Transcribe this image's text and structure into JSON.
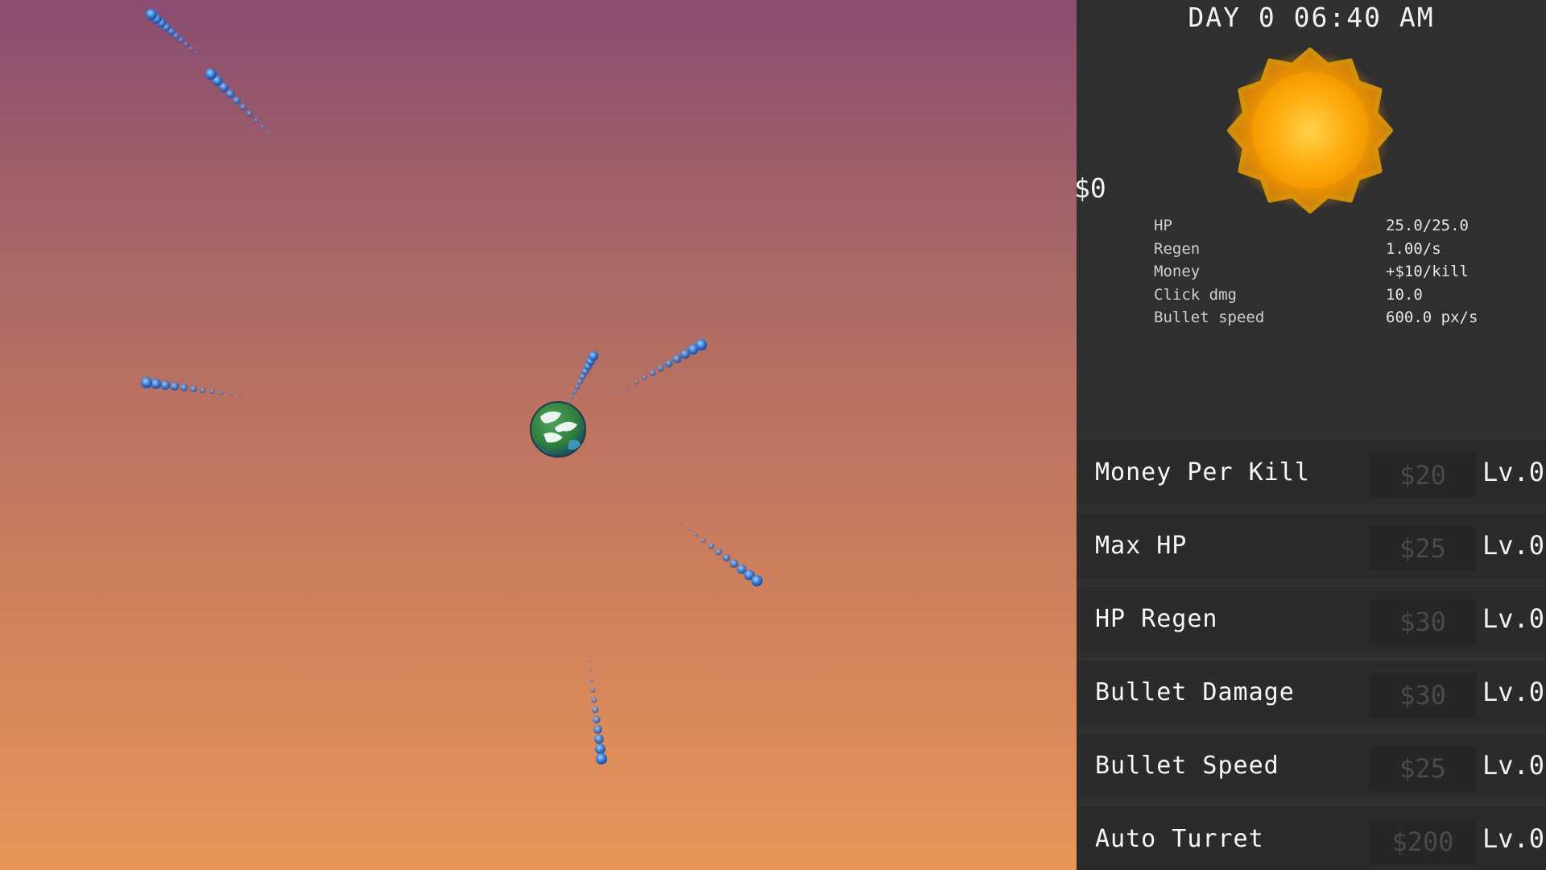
{
  "hud": {
    "clock": "DAY 0 06:40 AM",
    "money": "$0"
  },
  "stats": [
    {
      "label": "HP",
      "value": "25.0/25.0"
    },
    {
      "label": "Regen",
      "value": "1.00/s"
    },
    {
      "label": "Money",
      "value": "+$10/kill"
    },
    {
      "label": "Click dmg",
      "value": "10.0"
    },
    {
      "label": "Bullet speed",
      "value": "600.0 px/s"
    }
  ],
  "upgrades": [
    {
      "name": "Money Per Kill",
      "cost": "$20",
      "level": "Lv.0"
    },
    {
      "name": "Max HP",
      "cost": "$25",
      "level": "Lv.0"
    },
    {
      "name": "HP Regen",
      "cost": "$30",
      "level": "Lv.0"
    },
    {
      "name": "Bullet Damage",
      "cost": "$30",
      "level": "Lv.0"
    },
    {
      "name": "Bullet Speed",
      "cost": "$25",
      "level": "Lv.0"
    },
    {
      "name": "Auto Turret",
      "cost": "$200",
      "level": "Lv.0"
    }
  ],
  "icons": {
    "planet": "earth-planet-icon",
    "sun": "sun-icon",
    "enemy": "blue-comet-icon"
  },
  "colors": {
    "sky_top": "#8a4c70",
    "sky_bottom": "#e89658",
    "panel": "#2f2f2f",
    "comet": "#3a7bd5",
    "sun": "#ffb000"
  }
}
